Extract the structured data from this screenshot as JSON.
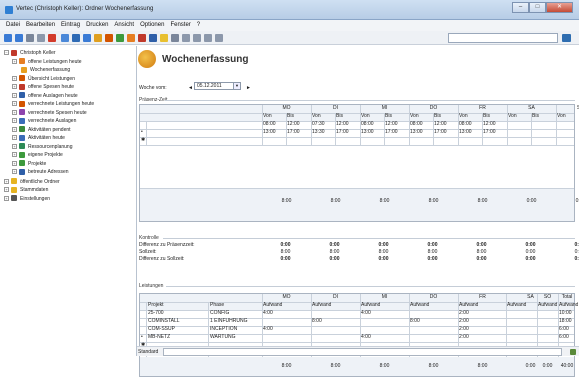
{
  "window": {
    "title": "Vertec (Christoph Keller): Ordner Wochenerfassung",
    "min": "–",
    "max": "□",
    "close": "✕"
  },
  "menu": [
    "Datei",
    "Bearbeiten",
    "Eintrag",
    "Drucken",
    "Ansicht",
    "Optionen",
    "Fenster",
    "?"
  ],
  "tree": [
    {
      "label": "Christoph Keller",
      "exp": "−",
      "color": "#c0392b"
    },
    {
      "label": "offene Leistungen heute",
      "exp": "+",
      "color": "#e67e22"
    },
    {
      "label": "Wochenerfassung",
      "exp": "",
      "color": "#e8a020"
    },
    {
      "label": "Übersicht Leistungen",
      "exp": "+",
      "color": "#d35400"
    },
    {
      "label": "offene Spesen heute",
      "exp": "+",
      "color": "#c0392b"
    },
    {
      "label": "offene Auslagen heute",
      "exp": "+",
      "color": "#2f5fa8"
    },
    {
      "label": "verrechnete Leistungen heute",
      "exp": "+",
      "color": "#d35400"
    },
    {
      "label": "verrechnete Spesen heute",
      "exp": "+",
      "color": "#8e44ad"
    },
    {
      "label": "verrechnete Auslagen",
      "exp": "+",
      "color": "#3b6cb8"
    },
    {
      "label": "Aktivitäten pendent",
      "exp": "+",
      "color": "#3b8a3b"
    },
    {
      "label": "Aktivitäten heute",
      "exp": "+",
      "color": "#3b6cb8"
    },
    {
      "label": "Ressourcenplanung",
      "exp": "+",
      "color": "#2e8b57"
    },
    {
      "label": "eigene Projekte",
      "exp": "+",
      "color": "#3d9a3d"
    },
    {
      "label": "Projekte",
      "exp": "+",
      "color": "#3d9a3d"
    },
    {
      "label": "betreute Adressen",
      "exp": "+",
      "color": "#2f5fa8"
    },
    {
      "label": "öffentliche Ordner",
      "exp": "+",
      "color": "#e6b422"
    },
    {
      "label": "Stammdaten",
      "exp": "+",
      "color": "#e6b422"
    },
    {
      "label": "Einstellungen",
      "exp": "+",
      "color": "#555555"
    }
  ],
  "page": {
    "title": "Wochenerfassung",
    "week_label": "Woche vom:",
    "week_value": "05.12.2011",
    "prev": "◄",
    "next": "►",
    "dd": "▼"
  },
  "praesenz": {
    "label": "Präsenz-Zeit",
    "days": [
      "MO",
      "DI",
      "MI",
      "DO",
      "FR",
      "SA",
      "SO"
    ],
    "von": "Von",
    "bis": "Bis",
    "rows": [
      [
        "08:00",
        "12:00",
        "07:30",
        "12:00",
        "08:00",
        "12:00",
        "08:00",
        "12:00",
        "08:00",
        "12:00",
        "",
        "",
        "",
        ""
      ],
      [
        "13:00",
        "17:00",
        "13:30",
        "17:00",
        "13:00",
        "17:00",
        "13:00",
        "17:00",
        "13:00",
        "17:00",
        "",
        "",
        "",
        ""
      ]
    ],
    "marker": "•",
    "newrow": "✱",
    "totals": [
      "8:00",
      "8:00",
      "8:00",
      "8:00",
      "8:00",
      "0:00",
      "0:00"
    ]
  },
  "kontrolle": {
    "label": "Kontrolle",
    "rows": [
      {
        "label": "Differenz zu Präsenzzeit:",
        "values": [
          "0:00",
          "0:00",
          "0:00",
          "0:00",
          "0:00",
          "0:00",
          "0:00"
        ]
      },
      {
        "label": "Sollzeit:",
        "values": [
          "8:00",
          "8:00",
          "8:00",
          "8:00",
          "8:00",
          "0:00",
          "0:00"
        ]
      },
      {
        "label": "Differenz zu Sollzeit:",
        "values": [
          "0:00",
          "0:00",
          "0:00",
          "0:00",
          "0:00",
          "0:00",
          "0:00"
        ]
      }
    ]
  },
  "leistungen": {
    "label": "Leistungen",
    "days": [
      "MO",
      "DI",
      "MI",
      "DO",
      "FR",
      "SA",
      "SO",
      "Total"
    ],
    "projekt": "Projekt",
    "phase": "Phase",
    "aufwand": "Aufwand",
    "rows": [
      {
        "projekt": "25-700",
        "phase": "CONFIG",
        "v": [
          "4:00",
          "",
          "4:00",
          "",
          "2:00",
          "",
          "",
          "10:00"
        ]
      },
      {
        "projekt": "COMINSTALL",
        "phase": "1 EINFÜHRUNG",
        "v": [
          "",
          "8:00",
          "",
          "8:00",
          "2:00",
          "",
          "",
          "18:00"
        ]
      },
      {
        "projekt": "COM-SSUP",
        "phase": "INCEPTION",
        "v": [
          "4:00",
          "",
          "",
          "",
          "2:00",
          "",
          "",
          "6:00"
        ]
      },
      {
        "projekt": "MB-NETZ",
        "phase": "WARTUNG",
        "v": [
          "",
          "",
          "4:00",
          "",
          "2:00",
          "",
          "",
          "6:00"
        ]
      }
    ],
    "marker": "•",
    "newrow": "✱",
    "totals": [
      "8:00",
      "8:00",
      "8:00",
      "8:00",
      "8:00",
      "0:00",
      "0:00",
      "40:00"
    ]
  },
  "status": {
    "label": "Standard"
  }
}
